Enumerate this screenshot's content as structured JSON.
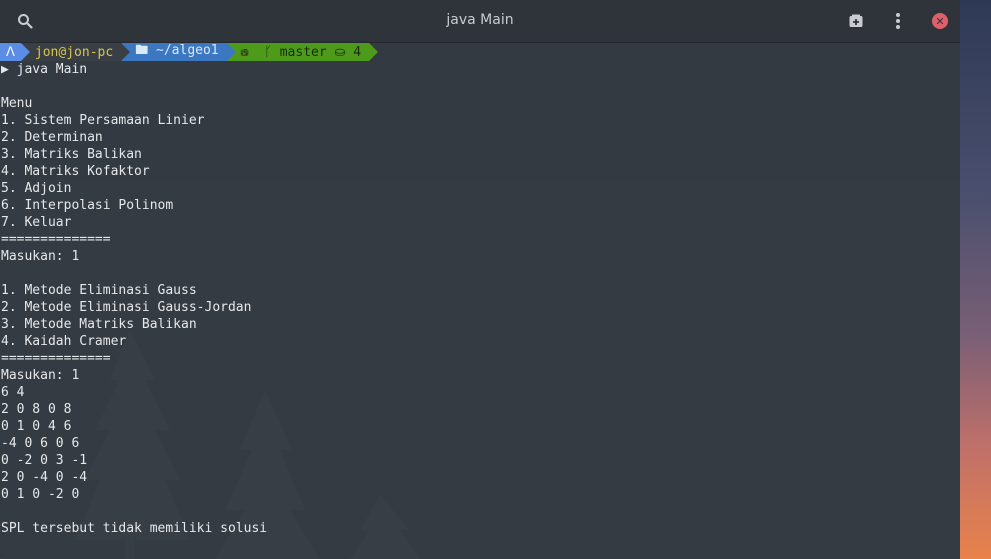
{
  "window": {
    "title": "java Main"
  },
  "icons": {
    "search": "search-icon",
    "new_tab": "new-tab-icon",
    "menu": "kebab-menu-icon",
    "close": "close-icon"
  },
  "prompt": {
    "os": "ᐱ",
    "user": "jon@jon-pc",
    "dir": "🖿 ~/algeo1",
    "git": "⛁  ᚴ master ⛀ 4"
  },
  "terminal": {
    "lines": [
      "▶ java Main",
      "",
      "Menu",
      "1. Sistem Persamaan Linier",
      "2. Determinan",
      "3. Matriks Balikan",
      "4. Matriks Kofaktor",
      "5. Adjoin",
      "6. Interpolasi Polinom",
      "7. Keluar",
      "==============",
      "Masukan: 1",
      "",
      "1. Metode Eliminasi Gauss",
      "2. Metode Eliminasi Gauss-Jordan",
      "3. Metode Matriks Balikan",
      "4. Kaidah Cramer",
      "==============",
      "Masukan: 1",
      "6 4",
      "2 0 8 0 8",
      "0 1 0 4 6",
      "-4 0 6 0 6",
      "0 -2 0 3 -1",
      "2 0 -4 0 -4",
      "0 1 0 -2 0",
      "",
      "SPL tersebut tidak memiliki solusi",
      "",
      "▶"
    ]
  },
  "colors": {
    "os_segment": "#5c8de6",
    "user_text": "#d7c64a",
    "dir_segment": "#3c78c2",
    "git_segment": "#4e9a1a",
    "close_button": "#e0606a"
  }
}
